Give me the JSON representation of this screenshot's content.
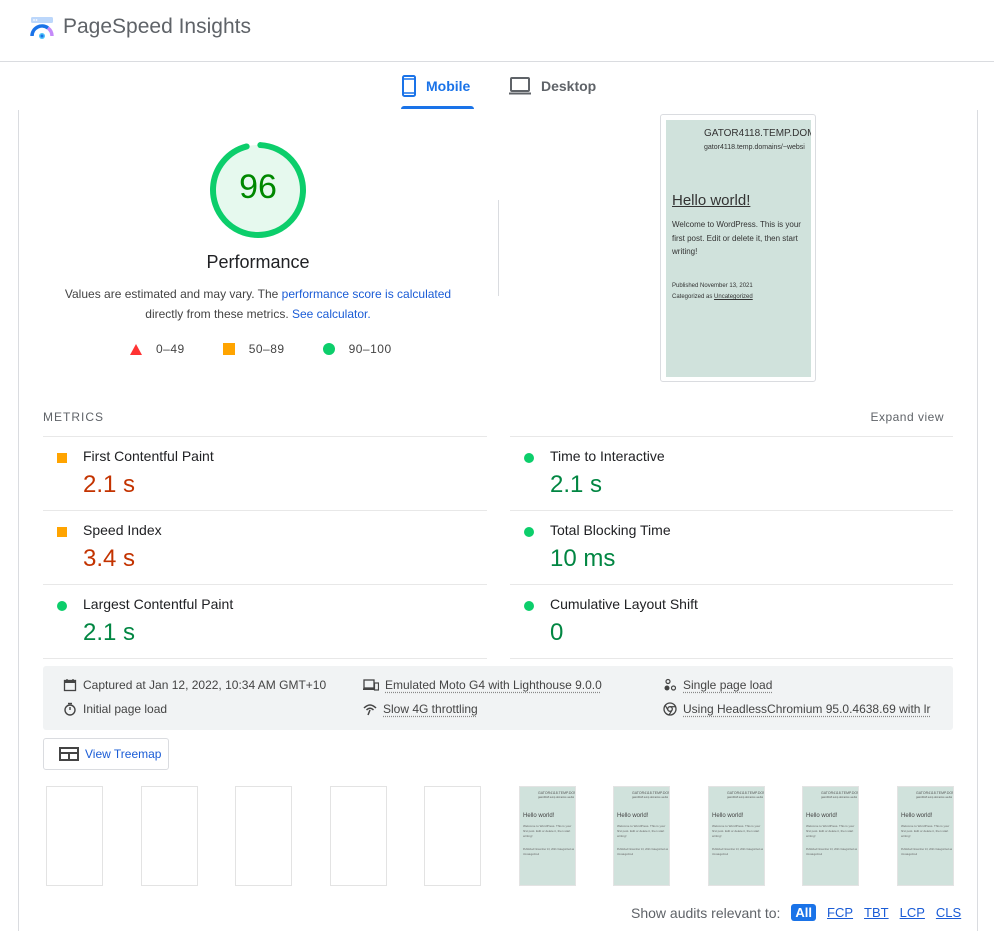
{
  "header": {
    "app_title": "PageSpeed Insights"
  },
  "tabs": [
    {
      "label": "Mobile",
      "icon": "smartphone-icon",
      "active": true
    },
    {
      "label": "Desktop",
      "icon": "laptop-icon",
      "active": false
    }
  ],
  "performance": {
    "score": "96",
    "score_value": 96,
    "title": "Performance",
    "desc_prefix": "Values are estimated and may vary. The ",
    "desc_link1": "performance score is calculated",
    "desc_middle": " directly from these metrics. ",
    "desc_link2": "See calculator.",
    "legend": [
      {
        "shape": "triangle",
        "range": "0–49",
        "color": "#ff3333"
      },
      {
        "shape": "square",
        "range": "50–89",
        "color": "#ffa400"
      },
      {
        "shape": "circle",
        "range": "90–100",
        "color": "#0cce6b"
      }
    ],
    "colors": {
      "pass": "#0cce6b",
      "pass_text": "#008800",
      "pass_bg": "#e6f9ee"
    }
  },
  "screenshot": {
    "site_title": "GATOR4118.TEMP.DOM",
    "site_url": "gator4118.temp.domains/~websi",
    "post_title": "Hello world!",
    "post_body": "Welcome to WordPress. This is your first post. Edit or delete it, then start writing!",
    "published": "Published November 13, 2021",
    "categorized_prefix": "Categorized as ",
    "category": "Uncategorized"
  },
  "metrics": {
    "label": "METRICS",
    "expand_label": "Expand view",
    "items": [
      {
        "name": "First Contentful Paint",
        "value": "2.1 s",
        "rating": "average"
      },
      {
        "name": "Time to Interactive",
        "value": "2.1 s",
        "rating": "pass"
      },
      {
        "name": "Speed Index",
        "value": "3.4 s",
        "rating": "average"
      },
      {
        "name": "Total Blocking Time",
        "value": "10 ms",
        "rating": "pass"
      },
      {
        "name": "Largest Contentful Paint",
        "value": "2.1 s",
        "rating": "pass"
      },
      {
        "name": "Cumulative Layout Shift",
        "value": "0",
        "rating": "pass"
      }
    ]
  },
  "runtime": {
    "captured": "Captured at Jan 12, 2022, 10:34 AM GMT+10",
    "initial_load": "Initial page load",
    "device": "Emulated Moto G4 with Lighthouse 9.0.0",
    "throttling": "Slow 4G throttling",
    "single_load": "Single page load",
    "browser": "Using HeadlessChromium 95.0.4638.69 with lr"
  },
  "treemap": {
    "label": "View Treemap"
  },
  "filmstrip": {
    "frames": [
      {
        "loaded": false
      },
      {
        "loaded": false
      },
      {
        "loaded": false
      },
      {
        "loaded": false
      },
      {
        "loaded": false
      },
      {
        "loaded": true
      },
      {
        "loaded": true
      },
      {
        "loaded": true
      },
      {
        "loaded": true
      },
      {
        "loaded": true
      }
    ],
    "thumb_site": "GATOR4118.TEMP.DOM",
    "thumb_url": "gator4118.temp.domains/~websi",
    "thumb_title": "Hello world!",
    "thumb_body": "Welcome to WordPress. This is your first post. Edit or delete it, then start writing!",
    "thumb_meta": "Published November 13, 2021 Categorized as Uncategorized"
  },
  "audit_filter": {
    "label": "Show audits relevant to:",
    "options": [
      {
        "label": "All",
        "active": true
      },
      {
        "label": "FCP",
        "active": false
      },
      {
        "label": "TBT",
        "active": false
      },
      {
        "label": "LCP",
        "active": false
      },
      {
        "label": "CLS",
        "active": false
      }
    ]
  }
}
